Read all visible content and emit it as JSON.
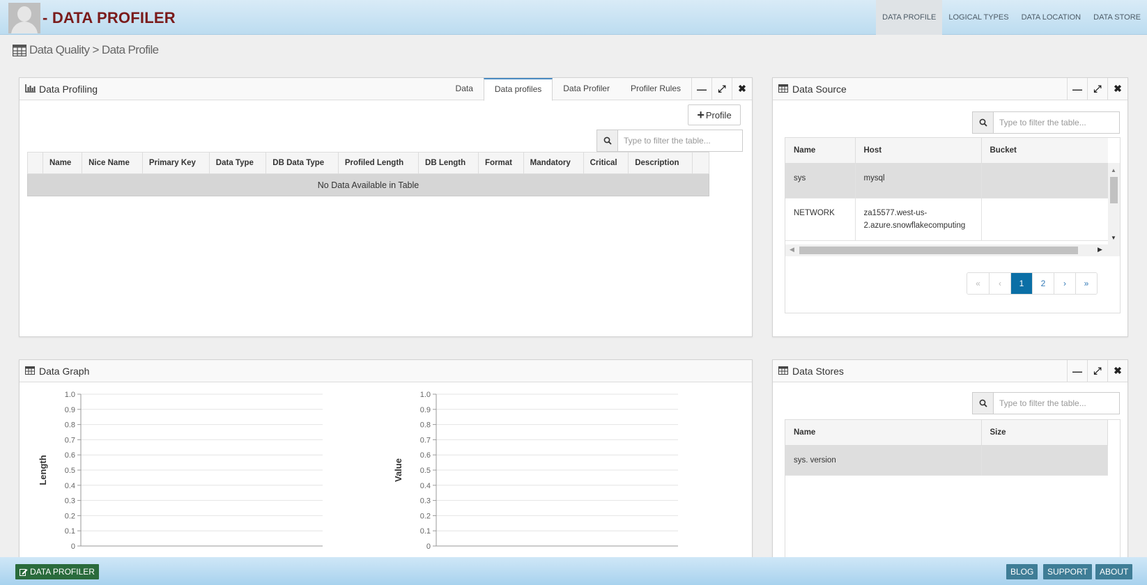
{
  "header": {
    "app_title": "- DATA PROFILER",
    "nav": [
      "DATA PROFILE",
      "LOGICAL TYPES",
      "DATA LOCATION",
      "DATA STORE"
    ],
    "active_nav": "DATA PROFILE"
  },
  "breadcrumb": {
    "text": "Data Quality > Data Profile",
    "icon": "table-icon"
  },
  "profiling": {
    "title": "Data Profiling",
    "tabs": [
      "Data",
      "Data profiles",
      "Data Profiler",
      "Profiler Rules"
    ],
    "active_tab": "Data profiles",
    "profile_button": "Profile",
    "filter_placeholder": "Type to filter the table...",
    "columns": [
      "Name",
      "Nice Name",
      "Primary Key",
      "Data Type",
      "DB Data Type",
      "Profiled Length",
      "DB Length",
      "Format",
      "Mandatory",
      "Critical",
      "Description"
    ],
    "empty_text": "No Data Available in Table"
  },
  "data_source": {
    "title": "Data Source",
    "filter_placeholder": "Type to filter the table...",
    "columns": [
      "Name",
      "Host",
      "Bucket"
    ],
    "rows": [
      {
        "name": "sys",
        "host": "mysql",
        "bucket": ""
      },
      {
        "name": "NETWORK",
        "host": "za15577.west-us-2.azure.snowflakecomputing",
        "bucket": ""
      }
    ],
    "pagination": {
      "first": "«",
      "prev": "‹",
      "pages": [
        "1",
        "2"
      ],
      "current": "1",
      "next": "›",
      "last": "»"
    }
  },
  "data_graph": {
    "title": "Data Graph"
  },
  "chart_data": [
    {
      "type": "line",
      "series": [],
      "ylabel": "Length",
      "xlabel": "",
      "ylim": [
        0,
        1.0
      ],
      "yticks": [
        "0",
        "0.1",
        "0.2",
        "0.3",
        "0.4",
        "0.5",
        "0.6",
        "0.7",
        "0.8",
        "0.9",
        "1.0"
      ],
      "grid": true
    },
    {
      "type": "line",
      "series": [],
      "ylabel": "Value",
      "xlabel": "",
      "ylim": [
        0,
        1.0
      ],
      "yticks": [
        "0",
        "0.1",
        "0.2",
        "0.3",
        "0.4",
        "0.5",
        "0.6",
        "0.7",
        "0.8",
        "0.9",
        "1.0"
      ],
      "grid": true
    }
  ],
  "data_stores": {
    "title": "Data Stores",
    "filter_placeholder": "Type to filter the table...",
    "columns": [
      "Name",
      "Size"
    ],
    "rows": [
      {
        "name": "sys. version",
        "size": ""
      }
    ]
  },
  "footer": {
    "left_button": "DATA PROFILER",
    "right_buttons": [
      "BLOG",
      "SUPPORT",
      "ABOUT"
    ]
  },
  "colors": {
    "title": "#7a1b1b",
    "accent": "#0b6fa6",
    "footer_green": "#2a6b3c",
    "footer_blue": "#3f7d96"
  }
}
